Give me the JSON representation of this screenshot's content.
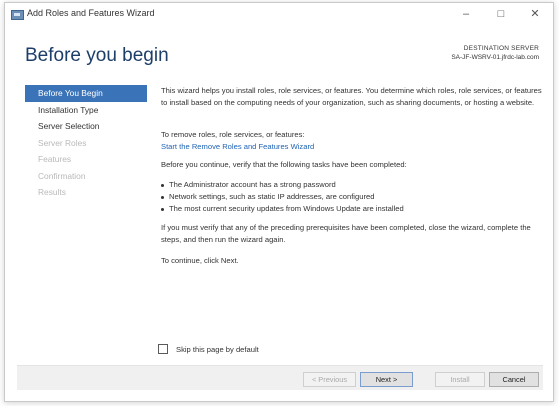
{
  "window": {
    "title": "Add Roles and Features Wizard",
    "controls": {
      "minimize": "–",
      "maximize": "□",
      "close": "✕"
    }
  },
  "header": {
    "heading": "Before you begin",
    "destination_label": "DESTINATION SERVER",
    "destination_server": "SA-JF-WSRV-01.jfrdc-lab.com"
  },
  "nav": {
    "items": [
      {
        "label": "Before You Begin",
        "state": "active"
      },
      {
        "label": "Installation Type",
        "state": "enabled"
      },
      {
        "label": "Server Selection",
        "state": "enabled"
      },
      {
        "label": "Server Roles",
        "state": "disabled"
      },
      {
        "label": "Features",
        "state": "disabled"
      },
      {
        "label": "Confirmation",
        "state": "disabled"
      },
      {
        "label": "Results",
        "state": "disabled"
      }
    ]
  },
  "content": {
    "intro": "This wizard helps you install roles, role services, or features. You determine which roles, role services, or features to install based on the computing needs of your organization, such as sharing documents, or hosting a website.",
    "remove_text": "To remove roles, role services, or features:",
    "remove_link": "Start the Remove Roles and Features Wizard",
    "verify_text": "Before you continue, verify that the following tasks have been completed:",
    "bullets": [
      "The Administrator account has a strong password",
      "Network settings, such as static IP addresses, are configured",
      "The most current security updates from Windows Update are installed"
    ],
    "if_must": "If you must verify that any of the preceding prerequisites have been completed, close the wizard, complete the steps, and then run the wizard again.",
    "continue_text": "To continue, click Next."
  },
  "skip": {
    "label": "Skip this page by default",
    "checked": false
  },
  "footer": {
    "previous": "< Previous",
    "next": "Next >",
    "install": "Install",
    "cancel": "Cancel"
  },
  "colors": {
    "heading": "#1d3e69",
    "nav_active_bg": "#3a73b8",
    "link": "#1f63b5",
    "disabled_text": "#b9b9b9"
  }
}
